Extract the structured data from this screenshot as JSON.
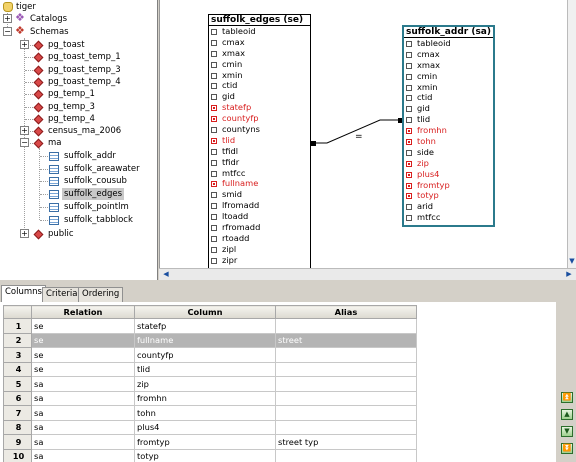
{
  "tree": {
    "root": {
      "label": "tiger",
      "icon": "database-icon"
    },
    "catalogs": {
      "label": "Catalogs",
      "icon": "catalog-icon"
    },
    "schemas": {
      "label": "Schemas",
      "icon": "schemas-icon"
    },
    "schema_items": [
      {
        "label": "pg_toast",
        "expander": "+"
      },
      {
        "label": "pg_toast_temp_1",
        "expander": ""
      },
      {
        "label": "pg_toast_temp_3",
        "expander": ""
      },
      {
        "label": "pg_toast_temp_4",
        "expander": ""
      },
      {
        "label": "pg_temp_1",
        "expander": ""
      },
      {
        "label": "pg_temp_3",
        "expander": ""
      },
      {
        "label": "pg_temp_4",
        "expander": ""
      },
      {
        "label": "census_ma_2006",
        "expander": "+"
      },
      {
        "label": "ma",
        "expander": "−"
      }
    ],
    "ma_tables": [
      "suffolk_addr",
      "suffolk_areawater",
      "suffolk_cousub",
      "suffolk_edges",
      "suffolk_pointlm",
      "suffolk_tabblock"
    ],
    "selected_table": "suffolk_edges",
    "public": {
      "label": "public",
      "expander": "+"
    }
  },
  "diagram": {
    "edges": {
      "title": "suffolk_edges (se)",
      "columns": [
        {
          "name": "tableoid",
          "checked": false
        },
        {
          "name": "cmax",
          "checked": false
        },
        {
          "name": "xmax",
          "checked": false
        },
        {
          "name": "cmin",
          "checked": false
        },
        {
          "name": "xmin",
          "checked": false
        },
        {
          "name": "ctid",
          "checked": false
        },
        {
          "name": "gid",
          "checked": false
        },
        {
          "name": "statefp",
          "checked": true
        },
        {
          "name": "countyfp",
          "checked": true
        },
        {
          "name": "countyns",
          "checked": false
        },
        {
          "name": "tlid",
          "checked": true
        },
        {
          "name": "tfidl",
          "checked": false
        },
        {
          "name": "tfidr",
          "checked": false
        },
        {
          "name": "mtfcc",
          "checked": false
        },
        {
          "name": "fullname",
          "checked": true
        },
        {
          "name": "smid",
          "checked": false
        },
        {
          "name": "lfromadd",
          "checked": false
        },
        {
          "name": "ltoadd",
          "checked": false
        },
        {
          "name": "rfromadd",
          "checked": false
        },
        {
          "name": "rtoadd",
          "checked": false
        },
        {
          "name": "zipl",
          "checked": false
        },
        {
          "name": "zipr",
          "checked": false
        }
      ]
    },
    "addr": {
      "title": "suffolk_addr (sa)",
      "columns": [
        {
          "name": "tableoid",
          "checked": false
        },
        {
          "name": "cmax",
          "checked": false
        },
        {
          "name": "xmax",
          "checked": false
        },
        {
          "name": "cmin",
          "checked": false
        },
        {
          "name": "xmin",
          "checked": false
        },
        {
          "name": "ctid",
          "checked": false
        },
        {
          "name": "gid",
          "checked": false
        },
        {
          "name": "tlid",
          "checked": false
        },
        {
          "name": "fromhn",
          "checked": true
        },
        {
          "name": "tohn",
          "checked": true
        },
        {
          "name": "side",
          "checked": false
        },
        {
          "name": "zip",
          "checked": true
        },
        {
          "name": "plus4",
          "checked": true
        },
        {
          "name": "fromtyp",
          "checked": true
        },
        {
          "name": "totyp",
          "checked": true
        },
        {
          "name": "arid",
          "checked": false
        },
        {
          "name": "mtfcc",
          "checked": false
        }
      ]
    },
    "join_label": "="
  },
  "tabs": [
    "Columns",
    "Criteria",
    "Ordering"
  ],
  "active_tab": 0,
  "grid": {
    "headers": [
      "Relation",
      "Column",
      "Alias"
    ],
    "rows": [
      {
        "n": "1",
        "relation": "se",
        "column": "statefp",
        "alias": ""
      },
      {
        "n": "2",
        "relation": "se",
        "column": "fullname",
        "alias": "street"
      },
      {
        "n": "3",
        "relation": "se",
        "column": "countyfp",
        "alias": ""
      },
      {
        "n": "4",
        "relation": "se",
        "column": "tlid",
        "alias": ""
      },
      {
        "n": "5",
        "relation": "sa",
        "column": "zip",
        "alias": ""
      },
      {
        "n": "6",
        "relation": "sa",
        "column": "fromhn",
        "alias": ""
      },
      {
        "n": "7",
        "relation": "sa",
        "column": "tohn",
        "alias": ""
      },
      {
        "n": "8",
        "relation": "sa",
        "column": "plus4",
        "alias": ""
      },
      {
        "n": "9",
        "relation": "sa",
        "column": "fromtyp",
        "alias": "street typ"
      },
      {
        "n": "10",
        "relation": "sa",
        "column": "totyp",
        "alias": ""
      }
    ],
    "selected_row": 1
  },
  "move_buttons": [
    "move-top-icon",
    "move-up-icon",
    "move-down-icon",
    "move-bottom-icon"
  ]
}
